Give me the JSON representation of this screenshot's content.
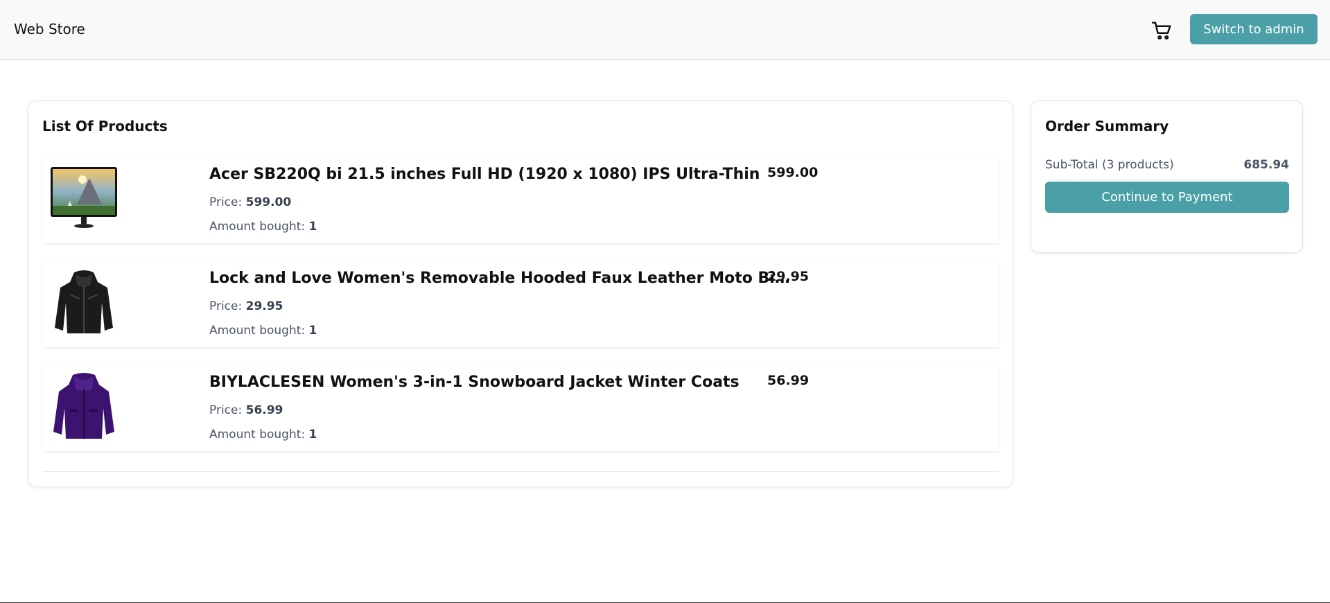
{
  "header": {
    "brand": "Web Store",
    "cart_icon": "cart-icon",
    "admin_button": "Switch to admin"
  },
  "products": {
    "title": "List Of Products",
    "price_label": "Price: ",
    "amount_label": "Amount bought: ",
    "items": [
      {
        "name": "Acer SB220Q bi 21.5 inches Full HD (1920 x 1080) IPS Ultra-Thin",
        "price": "599.00",
        "amount": "1",
        "total": "599.00",
        "image": "monitor-image"
      },
      {
        "name": "Lock and Love Women's Removable Hooded Faux Leather Moto Biker Jacket",
        "price": "29.95",
        "amount": "1",
        "total": "29.95",
        "image": "leather-jacket-image"
      },
      {
        "name": "BIYLACLESEN Women's 3-in-1 Snowboard Jacket Winter Coats",
        "price": "56.99",
        "amount": "1",
        "total": "56.99",
        "image": "purple-jacket-image"
      }
    ]
  },
  "summary": {
    "title": "Order Summary",
    "subtotal_label": "Sub-Total (3 products)",
    "subtotal_value": "685.94",
    "pay_button": "Continue to Payment"
  },
  "colors": {
    "accent": "#4aa0a6"
  }
}
